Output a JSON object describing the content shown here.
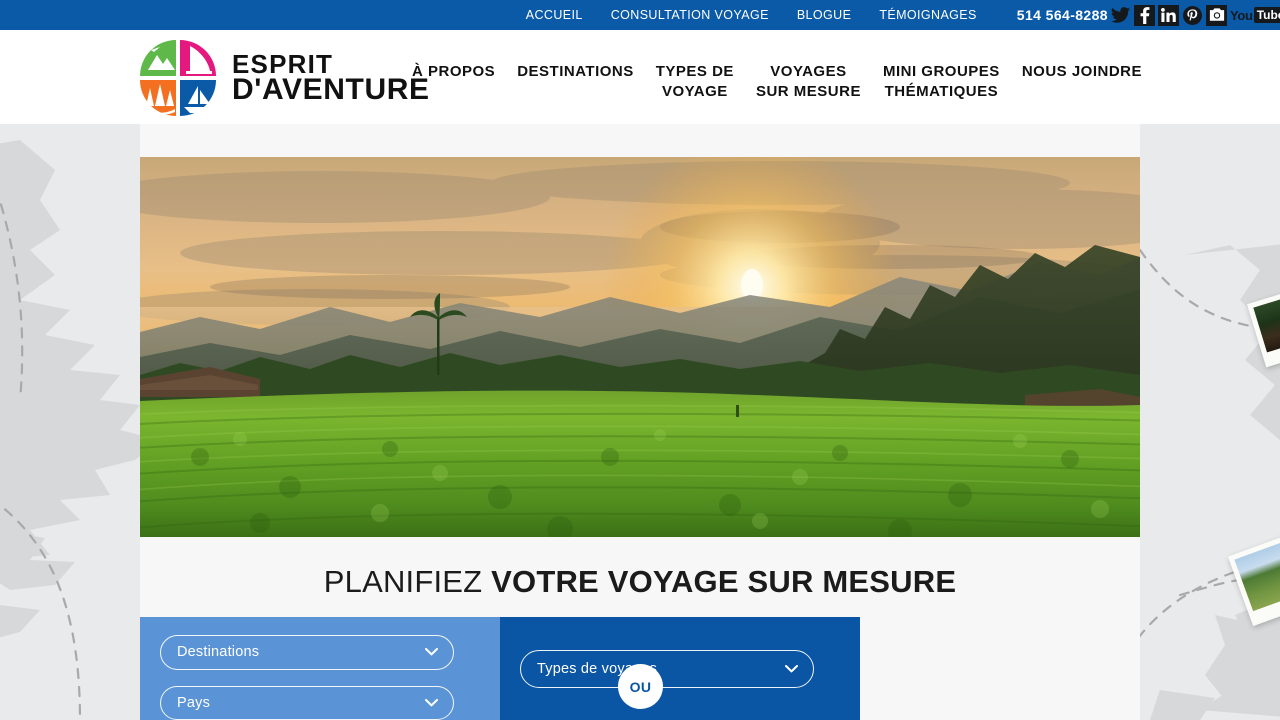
{
  "topbar": {
    "links": [
      {
        "label": "ACCUEIL",
        "name": "topnav-accueil"
      },
      {
        "label": "CONSULTATION VOYAGE",
        "name": "topnav-consultation-voyage"
      },
      {
        "label": "BLOGUE",
        "name": "topnav-blogue"
      },
      {
        "label": "TÉMOIGNAGES",
        "name": "topnav-temoignages"
      }
    ],
    "phone": "514 564-8288",
    "social": [
      {
        "name": "twitter-icon",
        "label": "Twitter"
      },
      {
        "name": "facebook-icon",
        "label": "Facebook"
      },
      {
        "name": "linkedin-icon",
        "label": "LinkedIn"
      },
      {
        "name": "pinterest-icon",
        "label": "Pinterest"
      },
      {
        "name": "instagram-icon",
        "label": "Instagram"
      },
      {
        "name": "youtube-icon",
        "label": "YouTube",
        "text_you": "You",
        "text_tube": "Tube"
      }
    ],
    "bg_color": "#0a5aa8"
  },
  "header": {
    "logo": {
      "line1": "ESPRIT",
      "line2": "D'AVENTURE"
    },
    "nav": [
      {
        "label": "À PROPOS",
        "name": "mainnav-a-propos"
      },
      {
        "label": "DESTINATIONS",
        "name": "mainnav-destinations"
      },
      {
        "label": "TYPES DE\nVOYAGE",
        "name": "mainnav-types-de-voyage"
      },
      {
        "label": "VOYAGES\nSUR MESURE",
        "name": "mainnav-voyages-sur-mesure"
      },
      {
        "label": "MINI GROUPES\nTHÉMATIQUES",
        "name": "mainnav-mini-groupes-thematiques"
      },
      {
        "label": "NOUS JOINDRE",
        "name": "mainnav-nous-joindre"
      }
    ]
  },
  "hero": {
    "alt": "Plantation de thé au coucher du soleil avec montagnes brumeuses"
  },
  "planner": {
    "heading_light": "PLANIFIEZ ",
    "heading_bold": "VOTRE VOYAGE SUR MESURE",
    "divider_label": "OU",
    "fields": [
      {
        "name": "select-destinations",
        "value": "Destinations",
        "panel": "left"
      },
      {
        "name": "select-pays",
        "value": "Pays",
        "panel": "left"
      },
      {
        "name": "select-types-de-voyages",
        "value": "Types de voyages",
        "panel": "right"
      }
    ],
    "panel_left_color": "#5b94d6",
    "panel_right_color": "#0a56a5"
  },
  "background": {
    "page_color": "#e9eaec",
    "content_color": "#f7f7f7",
    "map_land_color": "#d6d8da",
    "photos": [
      {
        "name": "bg-photo-canyon"
      },
      {
        "name": "bg-photo-plantation"
      }
    ]
  }
}
